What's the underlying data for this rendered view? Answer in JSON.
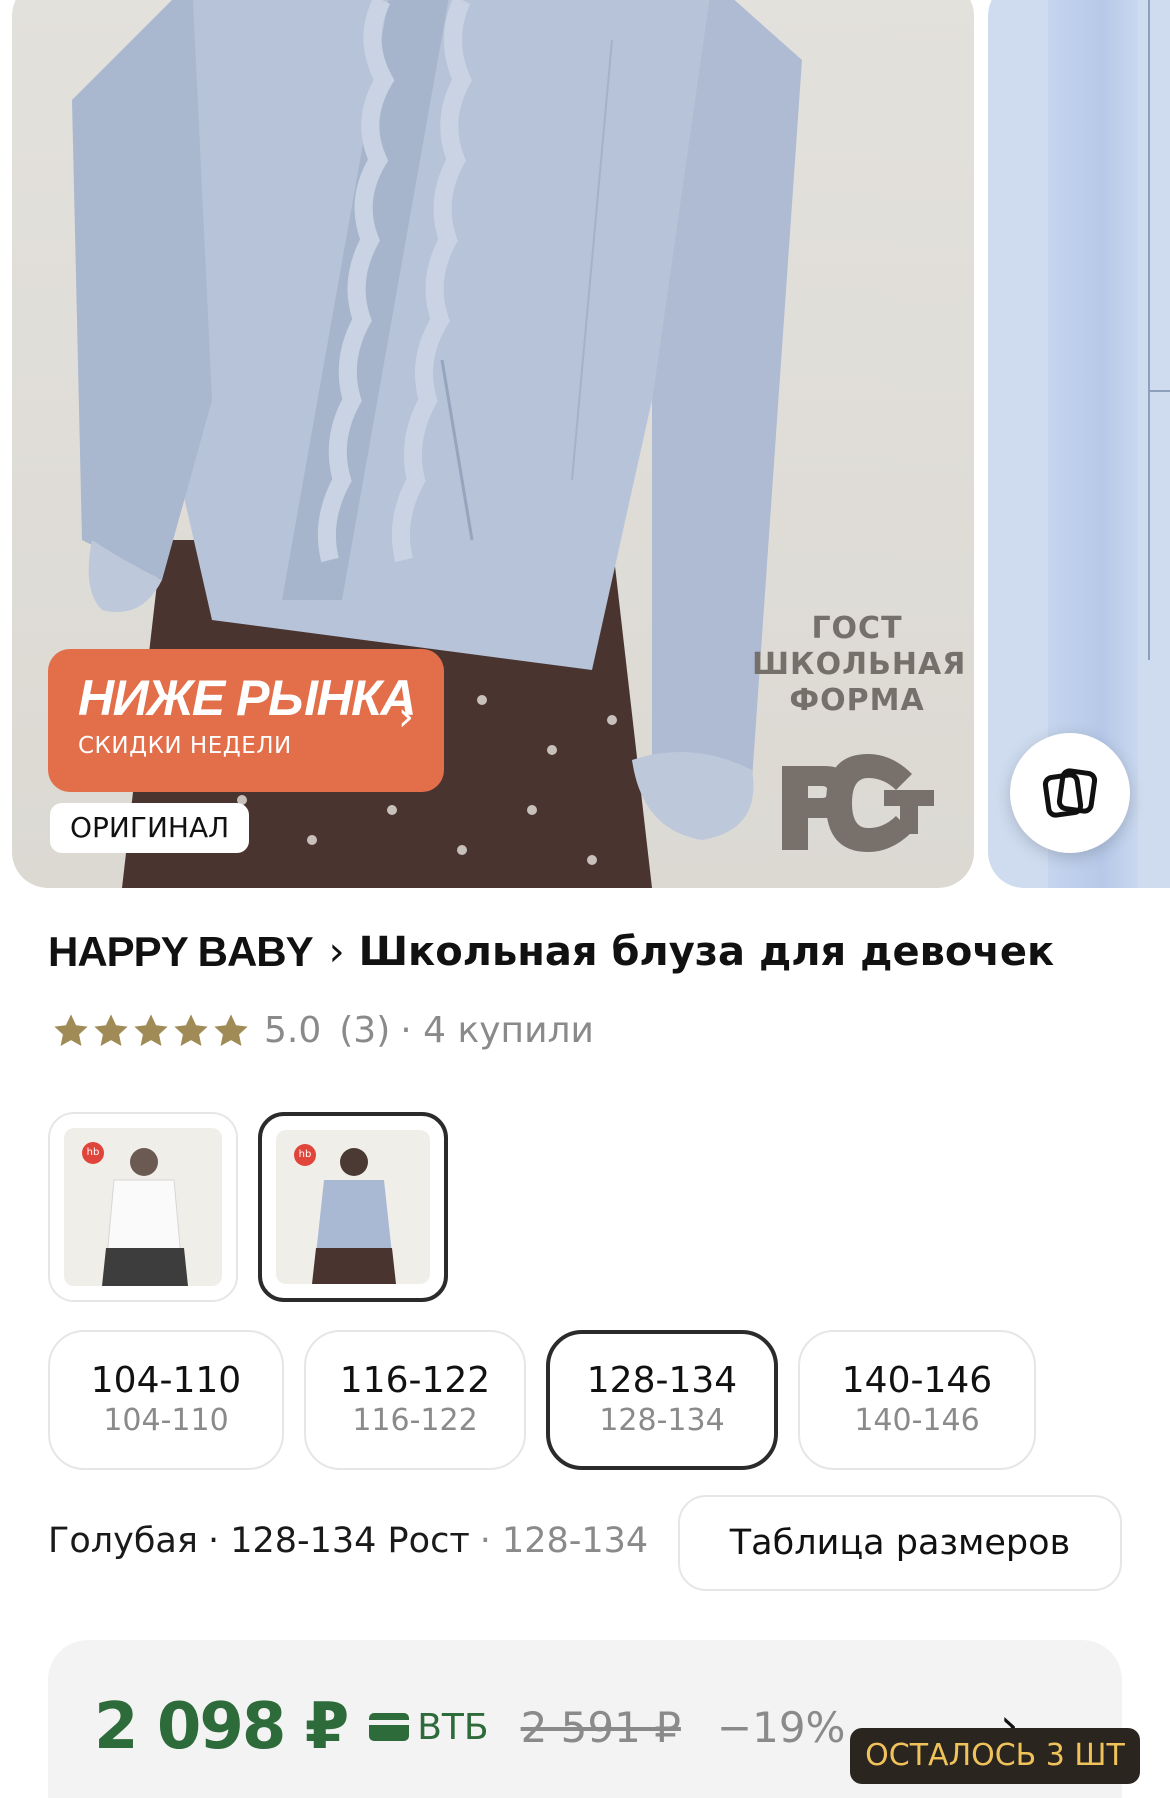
{
  "gallery": {
    "sticker": {
      "title": "НИЖЕ РЫНКА",
      "subtitle": "СКИДКИ НЕДЕЛИ",
      "color": "#e26f4a"
    },
    "badge": "ОРИГИНАЛ",
    "gost_text": [
      "ГОСТ",
      "ШКОЛЬНАЯ",
      "ФОРМА"
    ],
    "compare_icon": "compare-icon"
  },
  "product": {
    "brand": "HAPPY BABY",
    "name": "Школьная блуза для девочек",
    "rating": {
      "stars": 5,
      "value": "5.0",
      "reviews": "(3)",
      "bought": "· 4 купили",
      "star_color": "#a08a55"
    }
  },
  "variants": [
    {
      "name": "white",
      "selected": false,
      "thumb_color": "#ffffff",
      "logo": "hb"
    },
    {
      "name": "blue",
      "selected": true,
      "thumb_color": "#a9b9d3",
      "logo": "hb"
    }
  ],
  "sizes": [
    {
      "main": "104-110",
      "sub": "104-110",
      "selected": false
    },
    {
      "main": "116-122",
      "sub": "116-122",
      "selected": false
    },
    {
      "main": "128-134",
      "sub": "128-134",
      "selected": true
    },
    {
      "main": "140-146",
      "sub": "140-146",
      "selected": false
    }
  ],
  "selection": {
    "color": "Голубая",
    "size_label": "· 128-134 Рост",
    "size_extra": "· 128-134",
    "size_table_button": "Таблица размеров"
  },
  "price": {
    "current": "2 098 ₽",
    "bank": "ВТБ",
    "old": "2 591 ₽",
    "discount": "−19%",
    "accent": "#2e6b3a"
  },
  "stock_badge": "ОСТАЛОСЬ 3 ШТ"
}
